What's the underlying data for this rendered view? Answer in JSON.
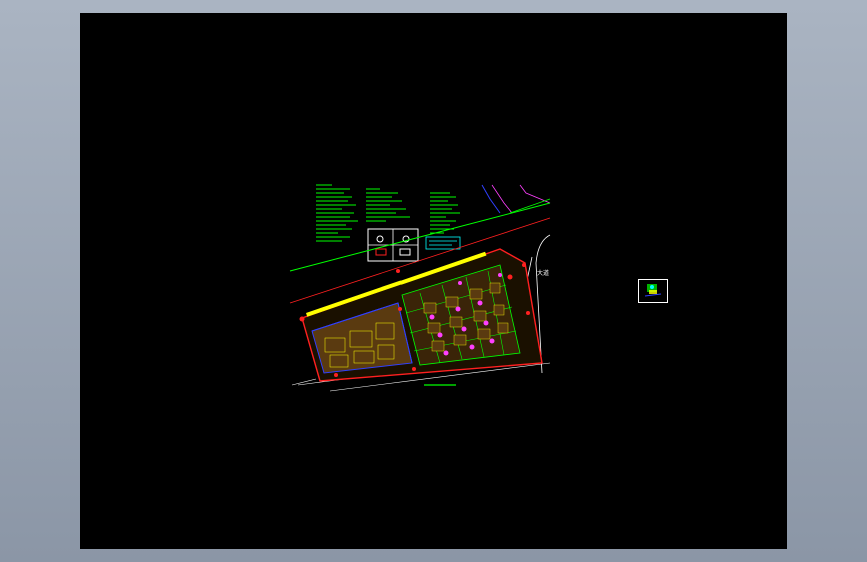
{
  "window": {
    "background_gradient": [
      "#aab4c2",
      "#8b96a6"
    ],
    "canvas_background": "#000000"
  },
  "drawing": {
    "road_label": "大道",
    "colors": {
      "green": "#00ff00",
      "red": "#ff2020",
      "yellow": "#ffff00",
      "blue": "#3040ff",
      "magenta": "#ff40ff",
      "white": "#ffffff",
      "brown": "#5a3a10",
      "cyan": "#00ffff"
    }
  },
  "thumbnail": {
    "icon": "drawing-preview-icon"
  }
}
